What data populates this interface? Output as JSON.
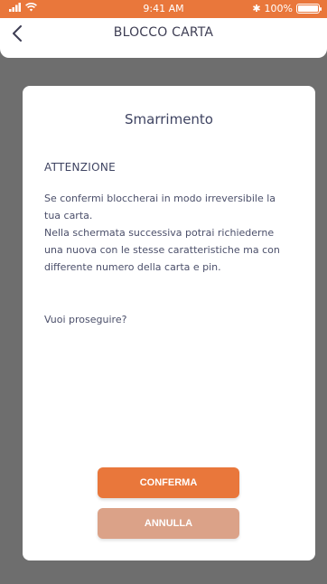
{
  "status_bar": {
    "time": "9:41 AM",
    "battery": "100%",
    "bluetooth_glyph": "✱",
    "accent_color": "#e9773b"
  },
  "header": {
    "title": "BLOCCO CARTA",
    "back_icon": "chevron-left-icon"
  },
  "dialog": {
    "title": "Smarrimento",
    "warning_heading": "ATTENZIONE",
    "body_lines": [
      "Se confermi bloccherai in modo irreversibile la",
      "tua carta.",
      "Nella schermata successiva potrai richiederne",
      "una nuova con le stesse caratteristiche ma con",
      "differente numero della carta e pin."
    ],
    "question": "Vuoi proseguire?",
    "confirm_label": "CONFERMA",
    "cancel_label": "ANNULLA",
    "confirm_color": "#e9773b",
    "cancel_color": "#dba288"
  }
}
